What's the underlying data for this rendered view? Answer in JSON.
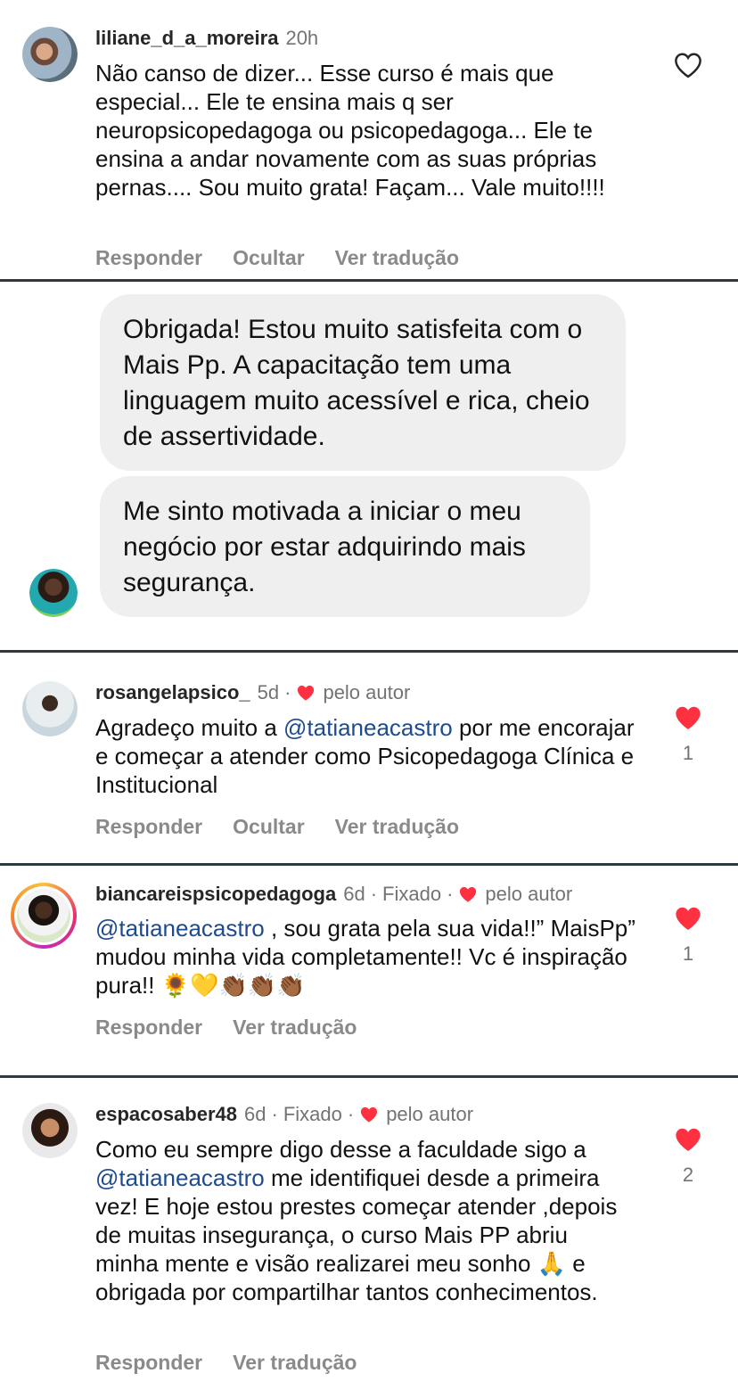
{
  "comments": [
    {
      "username": "liliane_d_a_moreira",
      "time": "20h",
      "text": "Não canso de dizer... Esse curso é mais que especial... Ele te ensina mais q ser neuropsicopedagoga ou psicopedagoga... Ele te ensina a andar novamente com as suas próprias pernas.... Sou muito grata! Façam... Vale muito!!!!",
      "actions": [
        "Responder",
        "Ocultar",
        "Ver tradução"
      ]
    },
    {
      "username": "rosangelapsico_",
      "time": "5d",
      "liked_by_author": "pelo autor",
      "text_before": "Agradeço muito a ",
      "mention": "@tatianeacastro",
      "text_after": " por me encorajar e começar a atender como Psicopedagoga Clínica e Institucional",
      "like_count": "1",
      "actions": [
        "Responder",
        "Ocultar",
        "Ver tradução"
      ]
    },
    {
      "username": "biancareispsicopedagoga",
      "time": "6d",
      "pinned": "Fixado",
      "liked_by_author": "pelo autor",
      "mention": "@tatianeacastro",
      "text_after": " , sou grata pela sua vida!!” MaisPp” mudou minha vida completamente!! Vc é inspiração pura!! 🌻💛👏🏾👏🏾👏🏾",
      "like_count": "1",
      "actions": [
        "Responder",
        "Ver tradução"
      ]
    },
    {
      "username": "espacosaber48",
      "time": "6d",
      "pinned": "Fixado",
      "liked_by_author": "pelo autor",
      "text_before": "Como eu sempre digo desse a faculdade sigo a ",
      "mention": "@tatianeacastro",
      "text_after": " me identifiquei desde a primeira vez! E hoje estou prestes começar atender ,depois de muitas insegurança, o curso Mais PP abriu minha mente e visão realizarei meu sonho 🙏 e obrigada por compartilhar tantos conhecimentos.",
      "like_count": "2",
      "actions": [
        "Responder",
        "Ver tradução"
      ]
    }
  ],
  "messages": [
    "Obrigada! Estou muito satisfeita com o Mais Pp. A capacitação tem uma linguagem muito acessível e rica, cheio de assertividade.",
    "Me sinto motivada a iniciar o meu negócio por estar adquirindo mais segurança."
  ],
  "colors": {
    "heart_red": "#ff3040",
    "mention_blue": "#1e4b8f",
    "divider": "#2f3a40",
    "bubble_bg": "#efefef"
  },
  "separator": "·"
}
